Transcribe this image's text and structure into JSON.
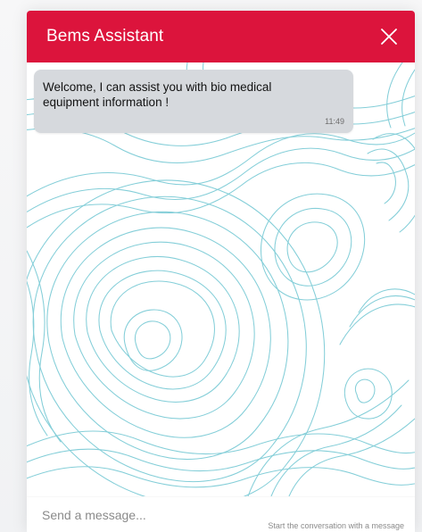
{
  "chat": {
    "title": "Bems Assistant",
    "close_icon": "close-icon",
    "accent_color": "#dc143c"
  },
  "messages": [
    {
      "text": "Welcome, I can assist you with bio medical equipment information !",
      "time": "11:49"
    }
  ],
  "composer": {
    "placeholder": "Send a message...",
    "hint": "Start the conversation with a message"
  }
}
